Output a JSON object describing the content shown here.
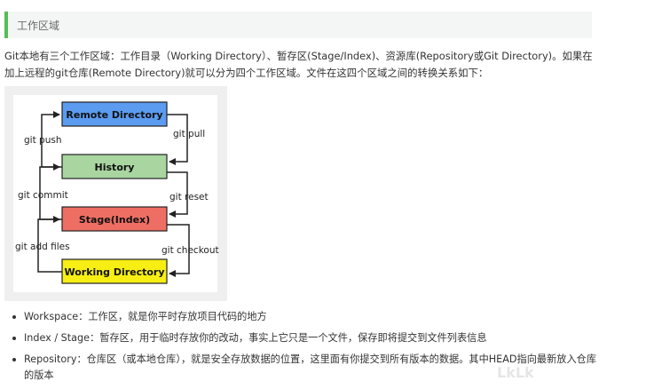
{
  "header": {
    "title": "工作区域"
  },
  "intro": {
    "text": "Git本地有三个工作区域：工作目录（Working Directory）、暂存区(Stage/Index)、资源库(Repository或Git Directory)。如果在加上远程的git仓库(Remote Directory)就可以分为四个工作区域。文件在这四个区域之间的转换关系如下："
  },
  "diagram": {
    "boxes": [
      {
        "id": "remote",
        "label": "Remote Directory",
        "color": "#5b9bf0"
      },
      {
        "id": "history",
        "label": "History",
        "color": "#a9d5a0"
      },
      {
        "id": "stage",
        "label": "Stage(Index)",
        "color": "#ef6e63"
      },
      {
        "id": "working",
        "label": "Working Directory",
        "color": "#f7ee14"
      }
    ],
    "left_labels": [
      "git push",
      "git commit",
      "git add files"
    ],
    "right_labels": [
      "git pull",
      "git reset",
      "git checkout"
    ]
  },
  "bullets": [
    "Workspace：工作区，就是你平时存放项目代码的地方",
    "Index / Stage：暂存区，用于临时存放你的改动，事实上它只是一个文件，保存即将提交到文件列表信息",
    "Repository：仓库区（或本地仓库），就是安全存放数据的位置，这里面有你提交到所有版本的数据。其中HEAD指向最新放入仓库的版本"
  ],
  "watermark": "LkLk",
  "colors": {
    "accent": "#55bd55"
  }
}
